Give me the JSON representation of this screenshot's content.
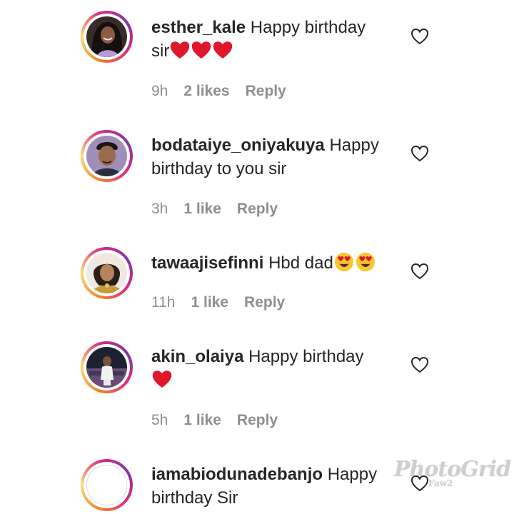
{
  "comments": [
    {
      "username": "esther_kale",
      "text": "Happy birthday sir",
      "emoji": [
        "red-heart",
        "red-heart",
        "red-heart"
      ],
      "time": "9h",
      "likes": "2 likes",
      "reply": "Reply"
    },
    {
      "username": "bodataiye_oniyakuya",
      "text": "Happy birthday to you sir",
      "emoji": [],
      "time": "3h",
      "likes": "1 like",
      "reply": "Reply"
    },
    {
      "username": "tawaajisefinni",
      "text": "Hbd dad",
      "emoji": [
        "heart-eyes",
        "heart-eyes"
      ],
      "time": "11h",
      "likes": "1 like",
      "reply": "Reply"
    },
    {
      "username": "akin_olaiya",
      "text": "Happy birthday",
      "emoji": [
        "red-heart"
      ],
      "time": "5h",
      "likes": "1 like",
      "reply": "Reply"
    },
    {
      "username": "iamabiodunadebanjo",
      "text": "Happy birthday Sir",
      "emoji": [],
      "time": "",
      "likes": "",
      "reply": ""
    }
  ],
  "icons": {
    "like": "heart-outline-icon",
    "story_ring": "gradient-ring"
  },
  "watermark": {
    "brand": "PhotoGrid",
    "sub": "Faw2"
  },
  "colors": {
    "text": "#262626",
    "meta": "#8e8e8e",
    "heart": "#e0162b"
  }
}
